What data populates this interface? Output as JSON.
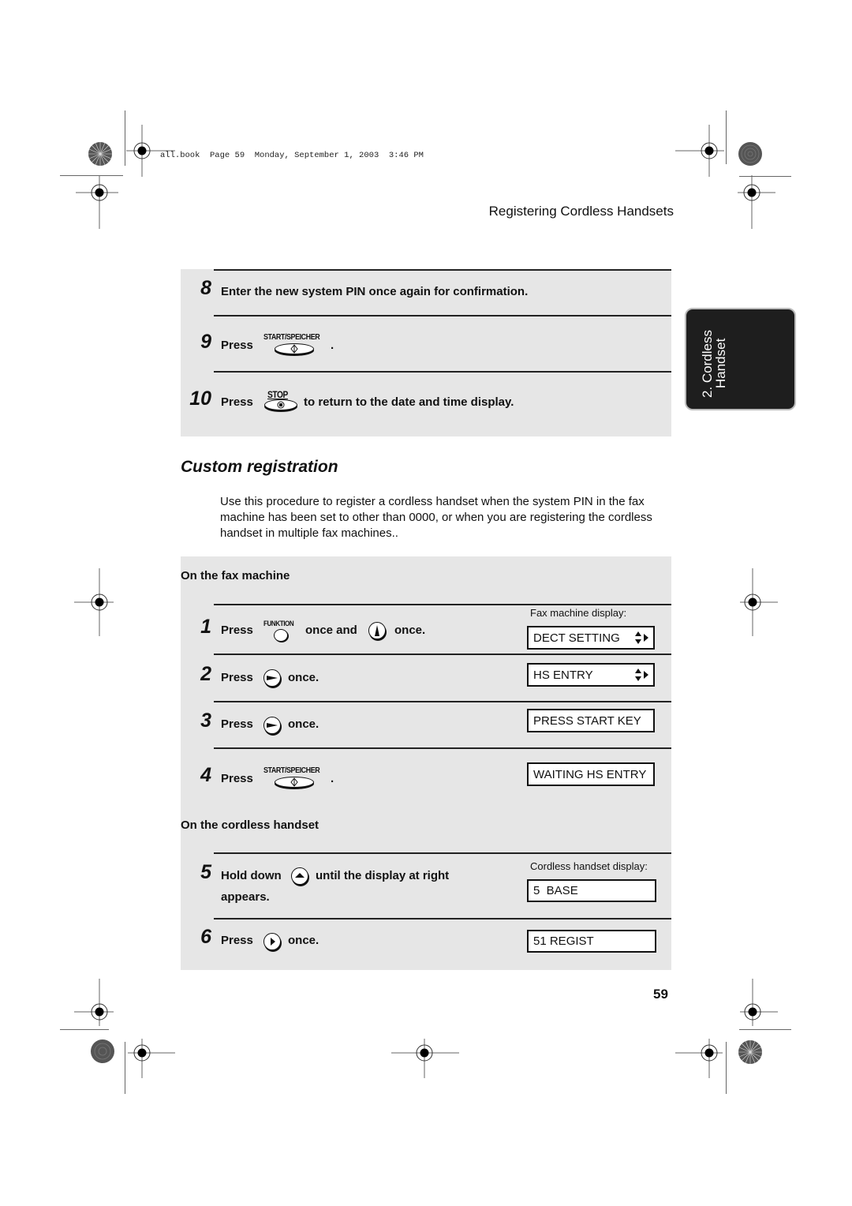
{
  "file_header": "all.book  Page 59  Monday, September 1, 2003  3:46 PM",
  "section_title": "Registering Cordless Handsets",
  "side_tab": {
    "line1": "2. Cordless",
    "line2": "Handset"
  },
  "top_steps": [
    {
      "num": "8",
      "text": "Enter the new system PIN once again for confirmation."
    },
    {
      "num": "9",
      "text_before": "Press",
      "key": "START/SPEICHER",
      "text_after": "."
    },
    {
      "num": "10",
      "text_before": "Press",
      "key": "STOP",
      "text_after": "to return to the date and time display."
    }
  ],
  "custom": {
    "heading": "Custom registration",
    "intro": "Use this procedure to register a cordless handset when the system PIN in the fax machine has been set to other than 0000, or when you are registering the cordless handset in multiple fax machines.."
  },
  "fax_section": {
    "heading": "On the fax machine",
    "display_caption": "Fax machine display:",
    "steps": [
      {
        "num": "1",
        "press": "Press",
        "key": "FUNKTION",
        "mid": "once and",
        "end": "once.",
        "display": "DECT SETTING",
        "display_arrows": true
      },
      {
        "num": "2",
        "press": "Press",
        "end": "once.",
        "display": "HS ENTRY",
        "display_arrows": true
      },
      {
        "num": "3",
        "press": "Press",
        "end": "once.",
        "display": "PRESS START KEY"
      },
      {
        "num": "4",
        "press": "Press",
        "key": "START/SPEICHER",
        "end": ".",
        "display": "WAITING HS ENTRY"
      }
    ]
  },
  "handset_section": {
    "heading": "On the cordless handset",
    "display_caption": "Cordless handset display:",
    "steps": [
      {
        "num": "5",
        "text_before": "Hold down",
        "text_after": "until the display at right",
        "line2": "appears.",
        "display": "5  BASE"
      },
      {
        "num": "6",
        "press": "Press",
        "end": "once.",
        "display": "51 REGIST"
      }
    ]
  },
  "page_number": "59",
  "icons": {
    "start_key": "start-speicher-key-icon",
    "stop_key": "stop-key-icon",
    "funktion_key": "funktion-key-icon",
    "up_nav": "up-arrow-button-icon",
    "right_nav": "right-arrow-button-icon",
    "handset_up": "handset-up-key-icon",
    "handset_right": "handset-right-key-icon",
    "lcd_arrows": "up-down-right-arrows-icon"
  }
}
